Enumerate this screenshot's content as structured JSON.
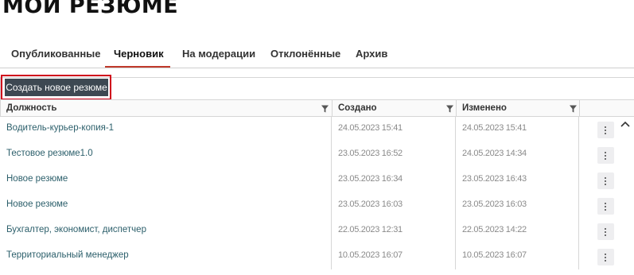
{
  "page": {
    "title": "МОИ РЕЗЮМЕ"
  },
  "tabs": [
    {
      "label": "Опубликованные",
      "active": false
    },
    {
      "label": "Черновик",
      "active": true
    },
    {
      "label": "На модерации",
      "active": false
    },
    {
      "label": "Отклонённые",
      "active": false
    },
    {
      "label": "Архив",
      "active": false
    }
  ],
  "toolbar": {
    "create_label": "Создать новое резюме"
  },
  "table": {
    "columns": [
      "Должность",
      "Создано",
      "Изменено"
    ],
    "rows": [
      {
        "position": "Водитель-курьер-копия-1",
        "created": "24.05.2023 15:41",
        "modified": "24.05.2023 15:41"
      },
      {
        "position": "Тестовое резюме1.0",
        "created": "23.05.2023 16:52",
        "modified": "24.05.2023 14:34"
      },
      {
        "position": "Новое резюме",
        "created": "23.05.2023 16:34",
        "modified": "23.05.2023 16:43"
      },
      {
        "position": "Новое резюме",
        "created": "23.05.2023 16:03",
        "modified": "23.05.2023 16:03"
      },
      {
        "position": "Бухгалтер, экономист, диспетчер",
        "created": "22.05.2023 12:31",
        "modified": "22.05.2023 14:22"
      },
      {
        "position": "Территориальный менеджер",
        "created": "10.05.2023 16:07",
        "modified": "10.05.2023 16:07"
      }
    ]
  },
  "colors": {
    "accent": "#c0392b",
    "button": "#3d4852",
    "highlight": "#d0021b",
    "link": "#2c5f6b"
  }
}
